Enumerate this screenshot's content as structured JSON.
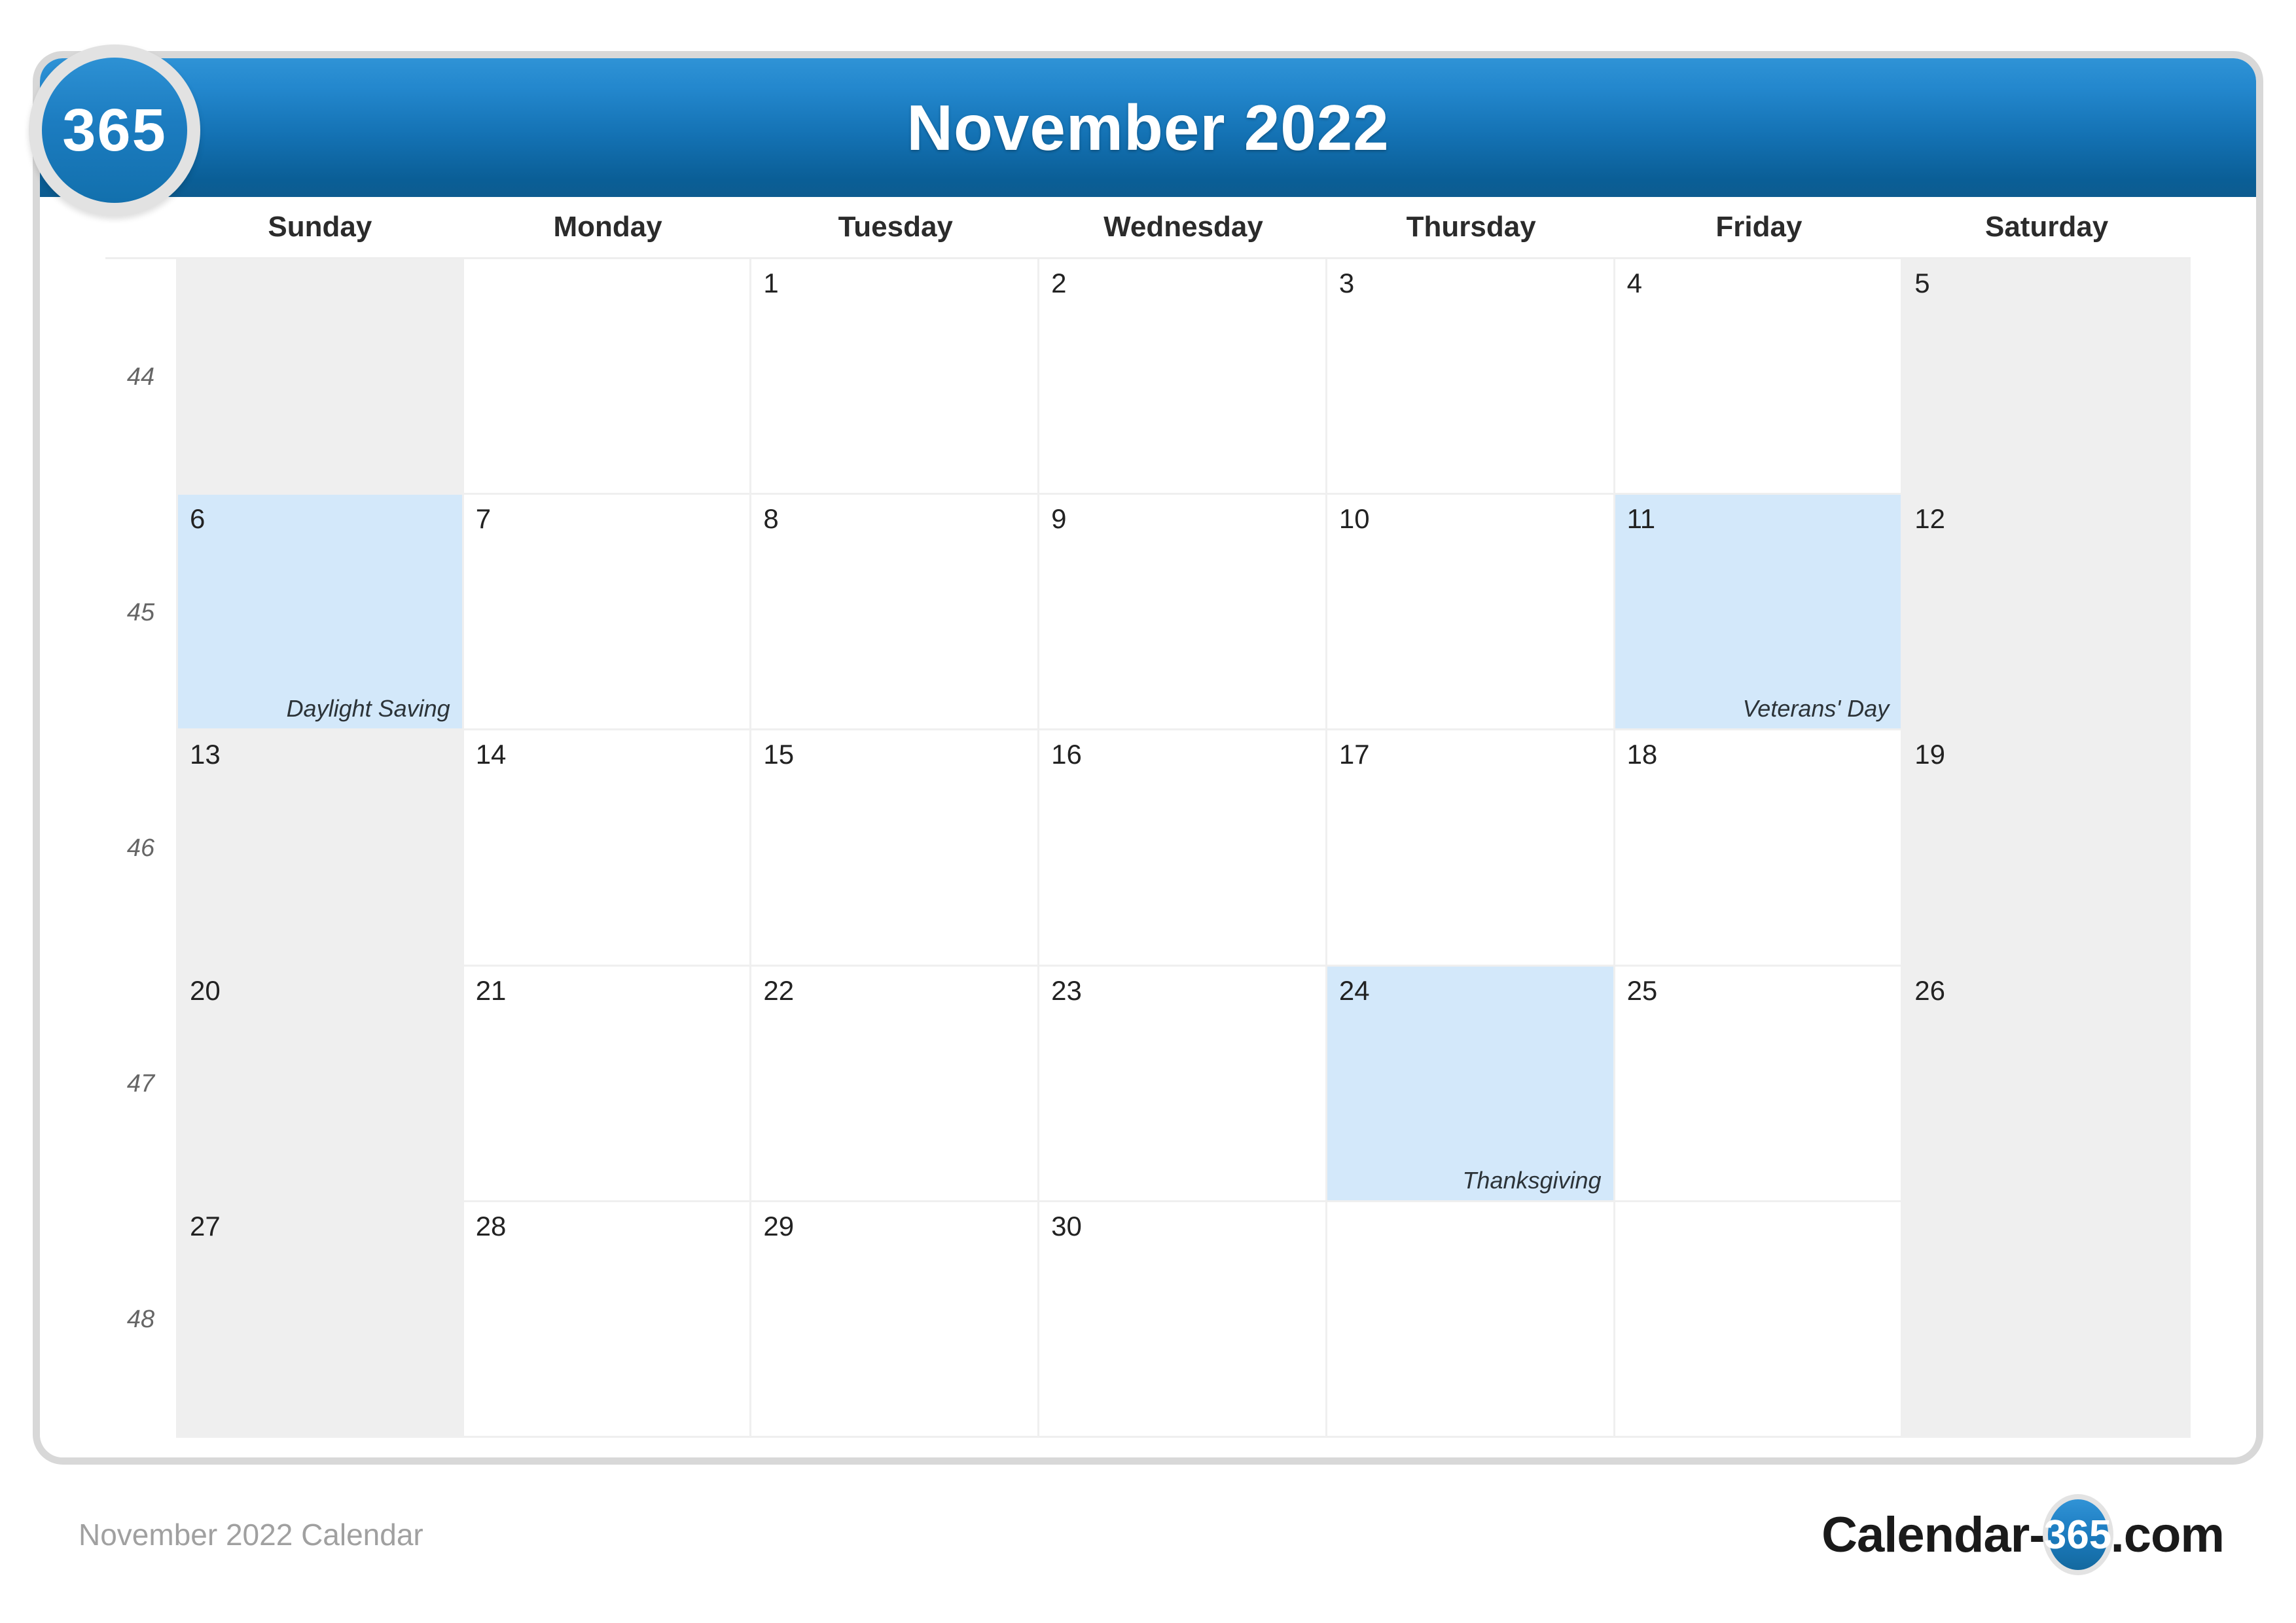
{
  "brand": {
    "logo_text": "365",
    "footer_logo_prefix": "Calendar-",
    "footer_logo_badge": "365",
    "footer_logo_suffix": ".com"
  },
  "header": {
    "title": "November 2022"
  },
  "footer": {
    "caption": "November 2022 Calendar"
  },
  "watermark": {
    "text": "365"
  },
  "colors": {
    "header_gradient_top": "#2f93d6",
    "header_gradient_bottom": "#0d5c90",
    "weekend_bg": "#efefef",
    "highlight_bg": "#d3e8fa",
    "grid_line": "#efefef",
    "card_border": "#d8d8d8",
    "footer_text": "#a0a0a0"
  },
  "calendar": {
    "weekday_headers": [
      "Sunday",
      "Monday",
      "Tuesday",
      "Wednesday",
      "Thursday",
      "Friday",
      "Saturday"
    ],
    "weeks": [
      {
        "week_number": "44",
        "days": [
          {
            "num": "",
            "label": "",
            "weekend": true,
            "highlight": false,
            "blank": true
          },
          {
            "num": "",
            "label": "",
            "weekend": false,
            "highlight": false,
            "blank": true
          },
          {
            "num": "1",
            "label": "",
            "weekend": false,
            "highlight": false,
            "blank": false
          },
          {
            "num": "2",
            "label": "",
            "weekend": false,
            "highlight": false,
            "blank": false
          },
          {
            "num": "3",
            "label": "",
            "weekend": false,
            "highlight": false,
            "blank": false
          },
          {
            "num": "4",
            "label": "",
            "weekend": false,
            "highlight": false,
            "blank": false
          },
          {
            "num": "5",
            "label": "",
            "weekend": true,
            "highlight": false,
            "blank": false
          }
        ]
      },
      {
        "week_number": "45",
        "days": [
          {
            "num": "6",
            "label": "Daylight Saving",
            "weekend": true,
            "highlight": true,
            "blank": false
          },
          {
            "num": "7",
            "label": "",
            "weekend": false,
            "highlight": false,
            "blank": false
          },
          {
            "num": "8",
            "label": "",
            "weekend": false,
            "highlight": false,
            "blank": false
          },
          {
            "num": "9",
            "label": "",
            "weekend": false,
            "highlight": false,
            "blank": false
          },
          {
            "num": "10",
            "label": "",
            "weekend": false,
            "highlight": false,
            "blank": false
          },
          {
            "num": "11",
            "label": "Veterans' Day",
            "weekend": false,
            "highlight": true,
            "blank": false
          },
          {
            "num": "12",
            "label": "",
            "weekend": true,
            "highlight": false,
            "blank": false
          }
        ]
      },
      {
        "week_number": "46",
        "days": [
          {
            "num": "13",
            "label": "",
            "weekend": true,
            "highlight": false,
            "blank": false
          },
          {
            "num": "14",
            "label": "",
            "weekend": false,
            "highlight": false,
            "blank": false
          },
          {
            "num": "15",
            "label": "",
            "weekend": false,
            "highlight": false,
            "blank": false
          },
          {
            "num": "16",
            "label": "",
            "weekend": false,
            "highlight": false,
            "blank": false
          },
          {
            "num": "17",
            "label": "",
            "weekend": false,
            "highlight": false,
            "blank": false
          },
          {
            "num": "18",
            "label": "",
            "weekend": false,
            "highlight": false,
            "blank": false
          },
          {
            "num": "19",
            "label": "",
            "weekend": true,
            "highlight": false,
            "blank": false
          }
        ]
      },
      {
        "week_number": "47",
        "days": [
          {
            "num": "20",
            "label": "",
            "weekend": true,
            "highlight": false,
            "blank": false
          },
          {
            "num": "21",
            "label": "",
            "weekend": false,
            "highlight": false,
            "blank": false
          },
          {
            "num": "22",
            "label": "",
            "weekend": false,
            "highlight": false,
            "blank": false
          },
          {
            "num": "23",
            "label": "",
            "weekend": false,
            "highlight": false,
            "blank": false
          },
          {
            "num": "24",
            "label": "Thanksgiving",
            "weekend": false,
            "highlight": true,
            "blank": false
          },
          {
            "num": "25",
            "label": "",
            "weekend": false,
            "highlight": false,
            "blank": false
          },
          {
            "num": "26",
            "label": "",
            "weekend": true,
            "highlight": false,
            "blank": false
          }
        ]
      },
      {
        "week_number": "48",
        "days": [
          {
            "num": "27",
            "label": "",
            "weekend": true,
            "highlight": false,
            "blank": false
          },
          {
            "num": "28",
            "label": "",
            "weekend": false,
            "highlight": false,
            "blank": false
          },
          {
            "num": "29",
            "label": "",
            "weekend": false,
            "highlight": false,
            "blank": false
          },
          {
            "num": "30",
            "label": "",
            "weekend": false,
            "highlight": false,
            "blank": false
          },
          {
            "num": "",
            "label": "",
            "weekend": false,
            "highlight": false,
            "blank": true
          },
          {
            "num": "",
            "label": "",
            "weekend": false,
            "highlight": false,
            "blank": true
          },
          {
            "num": "",
            "label": "",
            "weekend": true,
            "highlight": false,
            "blank": true
          }
        ]
      }
    ]
  }
}
